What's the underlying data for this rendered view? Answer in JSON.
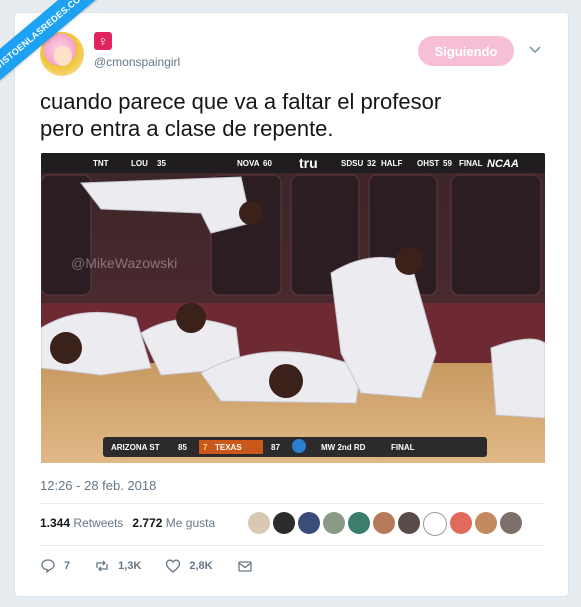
{
  "watermark": {
    "ribbon_text": "VISTOENLASREDES.COM"
  },
  "author": {
    "badge_glyph": "♀",
    "handle": "@cmonspaingirl"
  },
  "follow_button": {
    "label": "Siguiendo"
  },
  "tweet": {
    "text_line1": "cuando parece que va a faltar el profesor",
    "text_line2": "pero entra a clase de repente.",
    "timestamp": "12:26 - 28 feb. 2018"
  },
  "media": {
    "scoreboard": {
      "team1": "ARIZONA ST",
      "score1": "85",
      "team2": "TEXAS",
      "score2": "87",
      "seed2": "7",
      "network": "MW 2nd RD",
      "status": "FINAL"
    },
    "top_bar": {
      "tnt": "TNT",
      "lou": "LOU",
      "lou_score": "35",
      "nova": "NOVA",
      "nova_score": "60",
      "tru": "tru",
      "sdsu": "SDSU",
      "sdsu_score": "32",
      "half": "HALF",
      "ohst": "OHST",
      "ohst_score": "59",
      "final": "FINAL",
      "ncaa": "NCAA"
    },
    "watermark": "@MikeWazowski"
  },
  "stats": {
    "retweets_count": "1.344",
    "retweets_label": "Retweets",
    "likes_count": "2.772",
    "likes_label": "Me gusta"
  },
  "actions": {
    "replies": "7",
    "retweets": "1,3K",
    "likes": "2,8K"
  },
  "colors": {
    "accent": "#1da1f2",
    "follow_pink": "#f7bfd6",
    "badge_pink": "#e0245e"
  }
}
